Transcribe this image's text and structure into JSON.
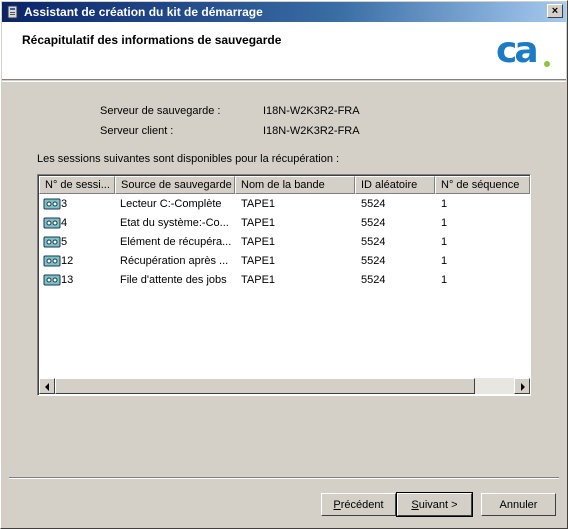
{
  "window": {
    "title": "Assistant de création du kit de démarrage",
    "close_label": "×"
  },
  "header": {
    "title": "Récapitulatif des informations de sauvegarde",
    "logo_text": "ca"
  },
  "info": {
    "backup_server_label": "Serveur de sauvegarde :",
    "backup_server_value": "I18N-W2K3R2-FRA",
    "client_server_label": "Serveur client :",
    "client_server_value": "I18N-W2K3R2-FRA"
  },
  "sessions": {
    "caption": "Les sessions suivantes sont disponibles pour la récupération :",
    "columns": [
      "N° de sessi...",
      "Source de sauvegarde",
      "Nom de la bande",
      "ID aléatoire",
      "N° de séquence"
    ],
    "rows": [
      {
        "session": "3",
        "source": "Lecteur C:-Complète",
        "tape": "TAPE1",
        "random_id": "5524",
        "sequence": "1"
      },
      {
        "session": "4",
        "source": "Etat du système:-Co...",
        "tape": "TAPE1",
        "random_id": "5524",
        "sequence": "1"
      },
      {
        "session": "5",
        "source": "Elément de récupéra...",
        "tape": "TAPE1",
        "random_id": "5524",
        "sequence": "1"
      },
      {
        "session": "12",
        "source": "Récupération après ...",
        "tape": "TAPE1",
        "random_id": "5524",
        "sequence": "1"
      },
      {
        "session": "13",
        "source": "File d'attente des jobs",
        "tape": "TAPE1",
        "random_id": "5524",
        "sequence": "1"
      }
    ],
    "row_icon": "tape-icon"
  },
  "buttons": {
    "previous_mnemonic": "P",
    "previous_rest": "récédent",
    "next_mnemonic": "S",
    "next_rest": "uivant >",
    "cancel": "Annuler"
  },
  "colors": {
    "title_gradient_start": "#0a246a",
    "title_gradient_end": "#a6caf0",
    "logo_blue": "#1c7bc4",
    "logo_green": "#8dc63f"
  }
}
